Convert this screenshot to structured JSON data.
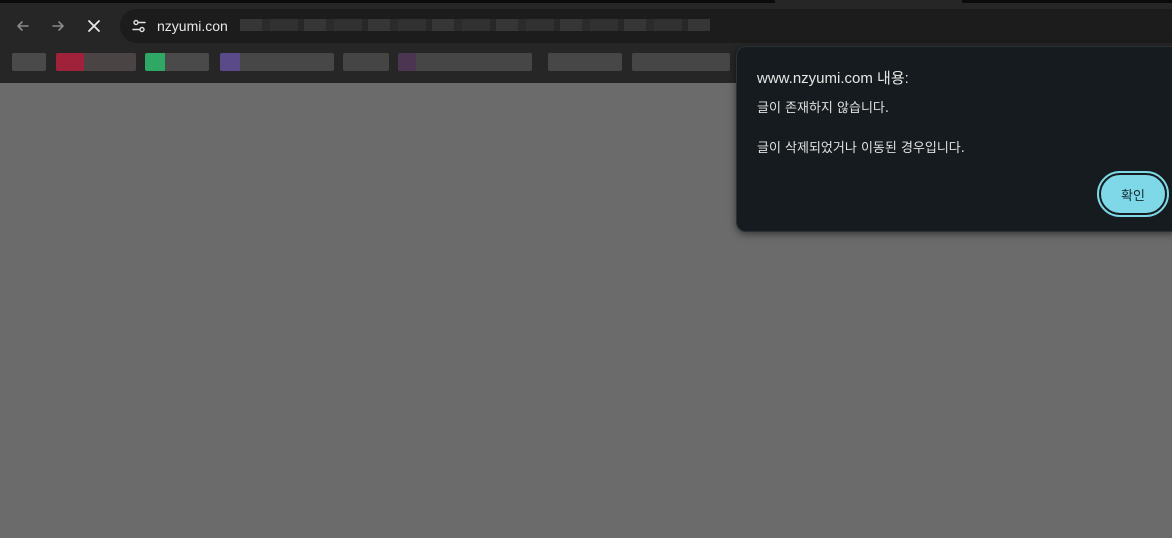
{
  "browser": {
    "url": "nzyumi.con",
    "icons": {
      "back": "arrow-left-icon",
      "forward": "arrow-right-icon",
      "stop": "close-icon",
      "site_info": "tune-icon"
    }
  },
  "dialog": {
    "title": "www.nzyumi.com 내용:",
    "message_line1": "글이 존재하지 않습니다.",
    "message_line2": "글이 삭제되었거나 이동된 경우입니다.",
    "ok_label": "확인",
    "accent_color": "#7fd8e8"
  },
  "colors": {
    "page_background": "#6b6b6b",
    "toolbar_background": "#262626",
    "dialog_background": "#151b1e"
  }
}
